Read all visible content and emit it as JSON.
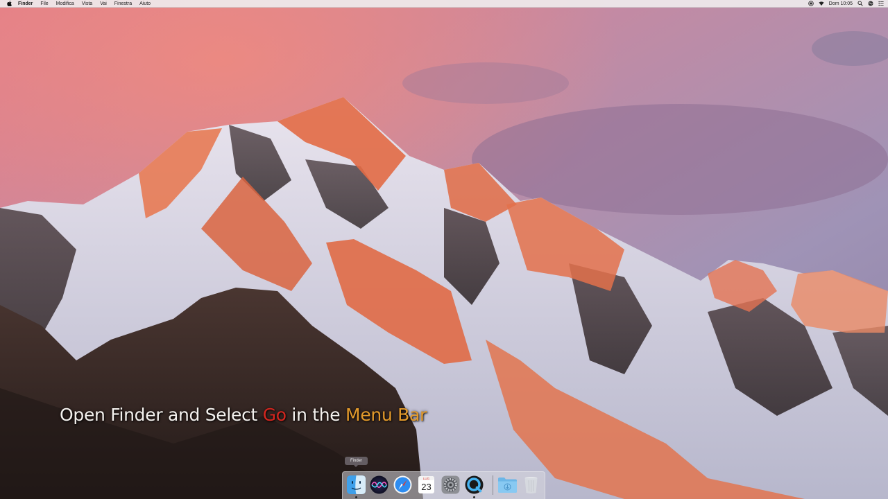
{
  "menubar": {
    "app_name": "Finder",
    "items": [
      "File",
      "Modifica",
      "Vista",
      "Vai",
      "Finestra",
      "Aiuto"
    ],
    "clock": "Dom 10:05",
    "status_icons": [
      "screen-record-icon",
      "wifi-icon",
      "spotlight-icon",
      "siri-icon",
      "notification-center-icon"
    ]
  },
  "caption": {
    "part1": "Open Finder and Select ",
    "go": "Go",
    "part2": " in the ",
    "menu_bar": "Menu Bar"
  },
  "dock": {
    "tooltip": "Finder",
    "calendar_month": "LUG",
    "calendar_day": "23",
    "apps": [
      "finder-icon",
      "siri-icon",
      "safari-icon",
      "calendar-icon",
      "system-preferences-icon",
      "quicktime-icon",
      "downloads-folder-icon",
      "trash-icon"
    ]
  },
  "colors": {
    "caption_highlight_go": "#d4261f",
    "caption_highlight_menubar": "#e39a2b"
  }
}
